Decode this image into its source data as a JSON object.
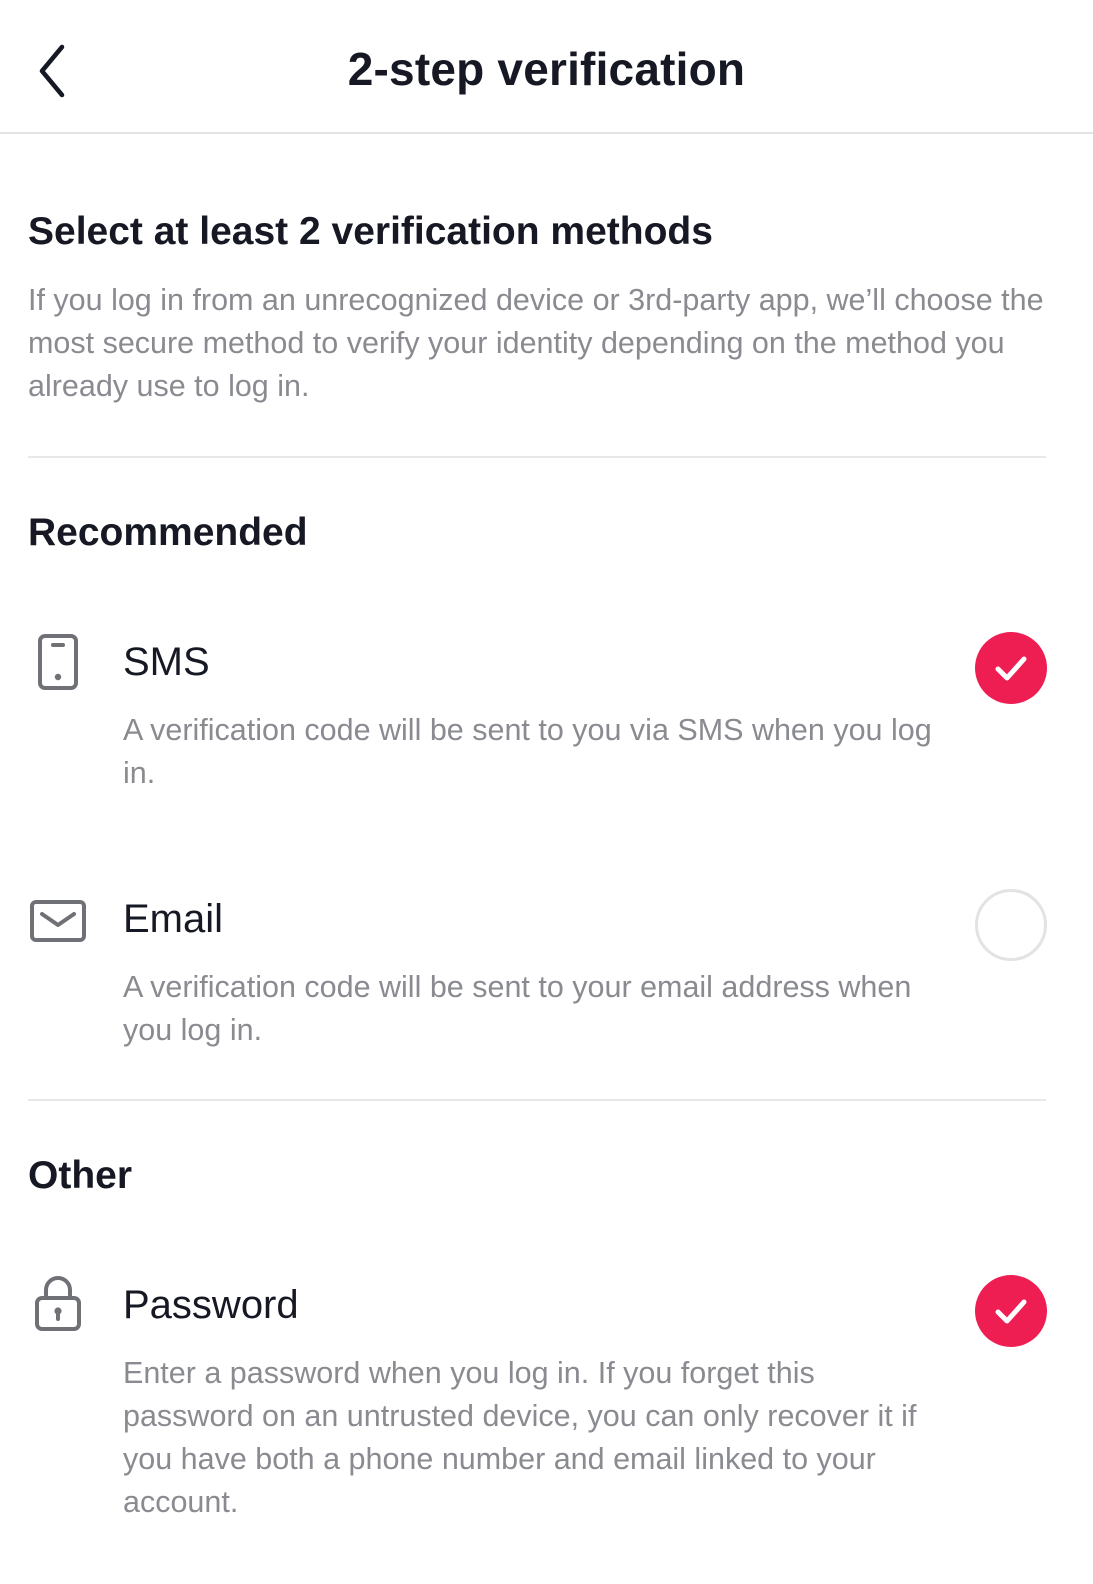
{
  "header": {
    "title": "2-step verification",
    "back_icon": "chevron-left-icon"
  },
  "intro": {
    "title": "Select at least 2 verification methods",
    "description": "If you log in from an unrecognized device or 3rd-party app, we’ll choose the most secure method to verify your identity depending on the method you already use to log in."
  },
  "sections": {
    "recommended": {
      "title": "Recommended",
      "items": [
        {
          "name": "SMS",
          "icon": "phone-icon",
          "description": "A verification code will be sent to you via SMS when you log in.",
          "selected": true
        },
        {
          "name": "Email",
          "icon": "mail-icon",
          "description": "A verification code will be sent to your email address when you log in.",
          "selected": false
        }
      ]
    },
    "other": {
      "title": "Other",
      "items": [
        {
          "name": "Password",
          "icon": "lock-icon",
          "description": "Enter a password when you log in. If you forget this password on an untrusted device, you can only recover it if you have both a phone number and email linked to your account.",
          "selected": true
        }
      ]
    }
  },
  "colors": {
    "accent": "#ee1d52",
    "text_primary": "#161823",
    "text_secondary": "#8a8b91",
    "divider": "#e8e8e9"
  }
}
